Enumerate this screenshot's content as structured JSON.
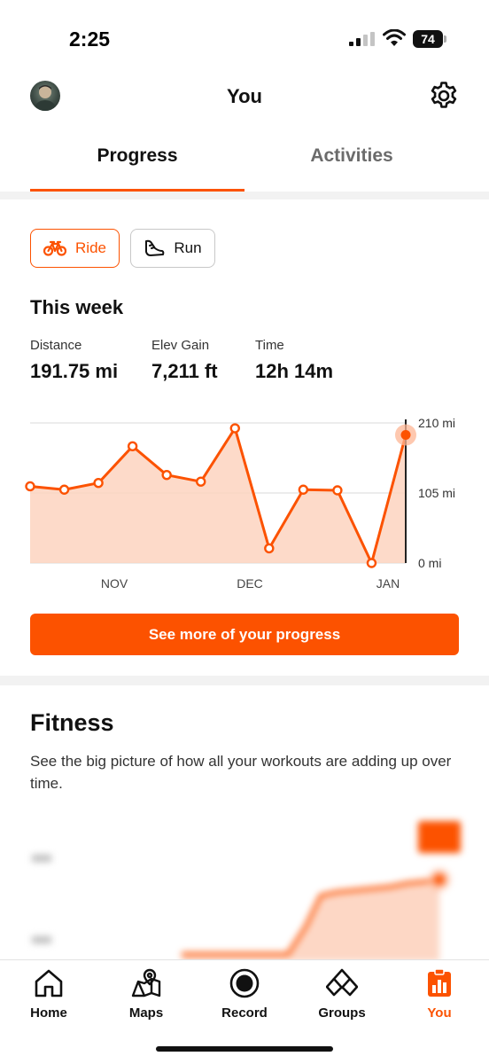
{
  "status_bar": {
    "time": "2:25",
    "battery": "74"
  },
  "header": {
    "title": "You",
    "avatar_icon": "user-avatar",
    "settings_icon": "gear-icon"
  },
  "tabs": [
    {
      "label": "Progress",
      "active": true
    },
    {
      "label": "Activities",
      "active": false
    }
  ],
  "sport_filters": [
    {
      "label": "Ride",
      "icon": "bike-icon",
      "selected": true
    },
    {
      "label": "Run",
      "icon": "shoe-icon",
      "selected": false
    }
  ],
  "this_week": {
    "title": "This week",
    "stats": [
      {
        "label": "Distance",
        "value": "191.75 mi"
      },
      {
        "label": "Elev Gain",
        "value": "7,211 ft"
      },
      {
        "label": "Time",
        "value": "12h 14m"
      }
    ]
  },
  "chart_data": {
    "type": "area",
    "x_labels": [
      "NOV",
      "DEC",
      "JAN"
    ],
    "y_ticks": [
      "210 mi",
      "105 mi",
      "0 mi"
    ],
    "ylim": [
      0,
      210
    ],
    "values": [
      115,
      110,
      120,
      175,
      132,
      122,
      202,
      22,
      110,
      109,
      0,
      192
    ],
    "color": "#fc5200",
    "fill": "#fdd3bf",
    "grid": true
  },
  "progress_button": {
    "label": "See more of your progress"
  },
  "fitness": {
    "title": "Fitness",
    "description": "See the big picture of how all your workouts are adding up over time."
  },
  "bottom_nav": [
    {
      "label": "Home",
      "icon": "home-icon",
      "active": false
    },
    {
      "label": "Maps",
      "icon": "map-icon",
      "active": false
    },
    {
      "label": "Record",
      "icon": "record-icon",
      "active": false
    },
    {
      "label": "Groups",
      "icon": "groups-icon",
      "active": false
    },
    {
      "label": "You",
      "icon": "you-icon",
      "active": true
    }
  ],
  "colors": {
    "accent": "#fc5200",
    "divider": "#f2f2f2",
    "muted_text": "#6b6b6b"
  }
}
